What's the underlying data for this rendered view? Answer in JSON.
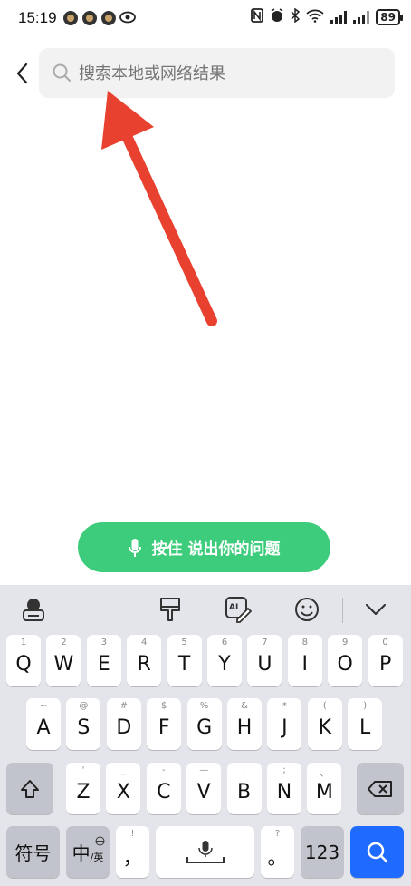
{
  "status_bar": {
    "time": "15:19",
    "battery": "89",
    "notification_icons": [
      "app-notification-icon",
      "app-notification-icon",
      "app-notification-icon",
      "eye-icon"
    ],
    "right_icons": [
      "nfc-icon",
      "alarm-icon",
      "bluetooth-icon",
      "wifi-6-icon",
      "signal-icon",
      "signal-icon",
      "battery-icon"
    ]
  },
  "search": {
    "placeholder": "搜索本地或网络结果"
  },
  "voice_button": {
    "label": "按住 说出你的问题"
  },
  "keyboard": {
    "toolbar_icons": [
      "keyboard-globe-icon",
      "skin-brush-icon",
      "ai-write-icon",
      "emoji-icon",
      "collapse-icon"
    ],
    "row1": [
      {
        "k": "Q",
        "s": "1"
      },
      {
        "k": "W",
        "s": "2"
      },
      {
        "k": "E",
        "s": "3"
      },
      {
        "k": "R",
        "s": "4"
      },
      {
        "k": "T",
        "s": "5"
      },
      {
        "k": "Y",
        "s": "6"
      },
      {
        "k": "U",
        "s": "7"
      },
      {
        "k": "I",
        "s": "8"
      },
      {
        "k": "O",
        "s": "9"
      },
      {
        "k": "P",
        "s": "0"
      }
    ],
    "row2": [
      {
        "k": "A",
        "s": "~"
      },
      {
        "k": "S",
        "s": "@"
      },
      {
        "k": "D",
        "s": "#"
      },
      {
        "k": "F",
        "s": "$"
      },
      {
        "k": "G",
        "s": "%"
      },
      {
        "k": "H",
        "s": "&"
      },
      {
        "k": "J",
        "s": "*"
      },
      {
        "k": "K",
        "s": "("
      },
      {
        "k": "L",
        "s": ")"
      }
    ],
    "row3": [
      {
        "k": "Z",
        "s": "'"
      },
      {
        "k": "X",
        "s": "_"
      },
      {
        "k": "C",
        "s": "-"
      },
      {
        "k": "V",
        "s": "—"
      },
      {
        "k": "B",
        "s": ":"
      },
      {
        "k": "N",
        "s": ";"
      },
      {
        "k": "M",
        "s": "、"
      }
    ],
    "symbols_label": "符号",
    "lang_main": "中",
    "lang_sub": "/英",
    "comma_label": "，",
    "comma_sub": "!",
    "period_label": "。",
    "period_sub": "?",
    "num_label": "123"
  }
}
